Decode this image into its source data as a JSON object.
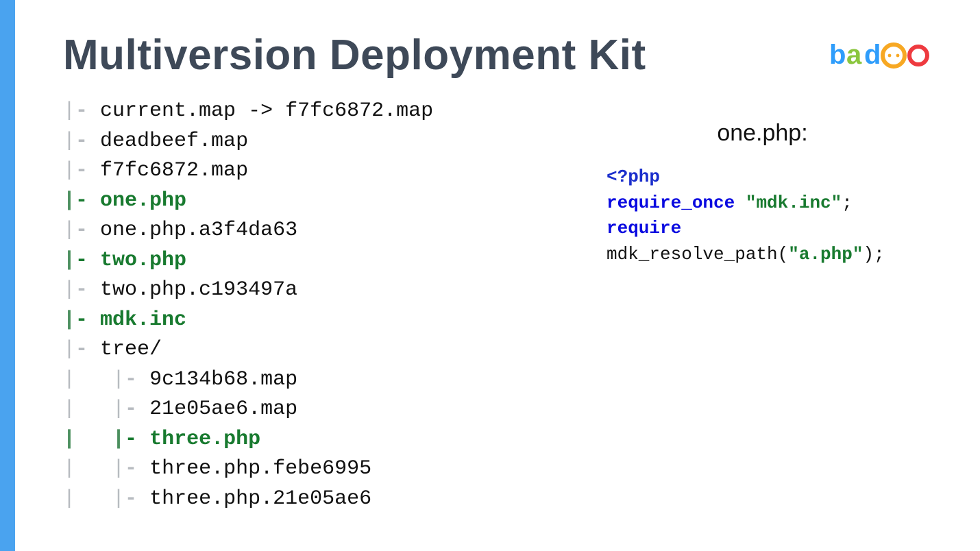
{
  "title": "Multiversion Deployment Kit",
  "logo": {
    "letters": [
      {
        "char": "b",
        "color": "#2f9dfb"
      },
      {
        "char": "a",
        "color": "#8bc63e"
      },
      {
        "char": "d",
        "color": "#2f9dfb"
      }
    ],
    "o1_color": "#f7a823",
    "o2_color": "#ee3a3f"
  },
  "tree": [
    {
      "indent": 0,
      "name": "current.map -> f7fc6872.map",
      "highlight": false
    },
    {
      "indent": 0,
      "name": "deadbeef.map",
      "highlight": false
    },
    {
      "indent": 0,
      "name": "f7fc6872.map",
      "highlight": false
    },
    {
      "indent": 0,
      "name": "one.php",
      "highlight": true
    },
    {
      "indent": 0,
      "name": "one.php.a3f4da63",
      "highlight": false
    },
    {
      "indent": 0,
      "name": "two.php",
      "highlight": true
    },
    {
      "indent": 0,
      "name": "two.php.c193497a",
      "highlight": false
    },
    {
      "indent": 0,
      "name": "mdk.inc",
      "highlight": true
    },
    {
      "indent": 0,
      "name": "tree/",
      "highlight": false
    },
    {
      "indent": 1,
      "name": "9c134b68.map",
      "highlight": false
    },
    {
      "indent": 1,
      "name": "21e05ae6.map",
      "highlight": false
    },
    {
      "indent": 1,
      "name": "three.php",
      "highlight": true
    },
    {
      "indent": 1,
      "name": "three.php.febe6995",
      "highlight": false
    },
    {
      "indent": 1,
      "name": "three.php.21e05ae6",
      "highlight": false
    }
  ],
  "code": {
    "title": "one.php:",
    "l1_tag": "<?php",
    "l2_kw": "require_once",
    "l2_str": "\"mdk.inc\"",
    "l2_end": ";",
    "l3_kw": "require",
    "l4_func": "mdk_resolve_path(",
    "l4_str": "\"a.php\"",
    "l4_end": ");"
  }
}
